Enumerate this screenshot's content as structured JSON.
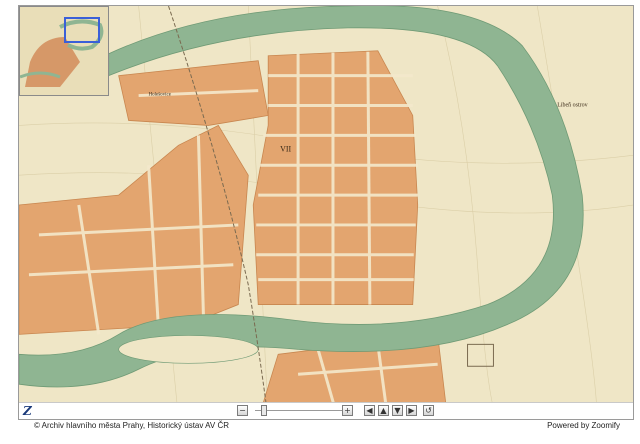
{
  "footer": {
    "attribution": "© Archiv hlavního města Prahy, Historický ústav AV ČR",
    "powered_by": "Powered by Zoomify"
  },
  "toolbar": {
    "logo_glyph": "Z",
    "zoom_out_glyph": "−",
    "zoom_in_glyph": "+",
    "pan_left_glyph": "◀",
    "pan_up_glyph": "▲",
    "pan_down_glyph": "▼",
    "pan_right_glyph": "▶",
    "reset_glyph": "↺",
    "zoom_level": 0.1
  },
  "map": {
    "labels": {
      "district": "VII",
      "libenske": "Libeň ostrov",
      "holesovice": "Holešovice"
    }
  },
  "colors": {
    "paper": "#efe6c6",
    "river": "#8fb592",
    "built": "#e3a56f",
    "navigator_frame": "#3a5fd8"
  },
  "icons": {
    "logo": "zoomify-z-icon",
    "zoom_out": "minus-icon",
    "zoom_in": "plus-icon",
    "pan_left": "arrow-left-icon",
    "pan_up": "arrow-up-icon",
    "pan_down": "arrow-down-icon",
    "pan_right": "arrow-right-icon",
    "reset": "reset-icon"
  }
}
